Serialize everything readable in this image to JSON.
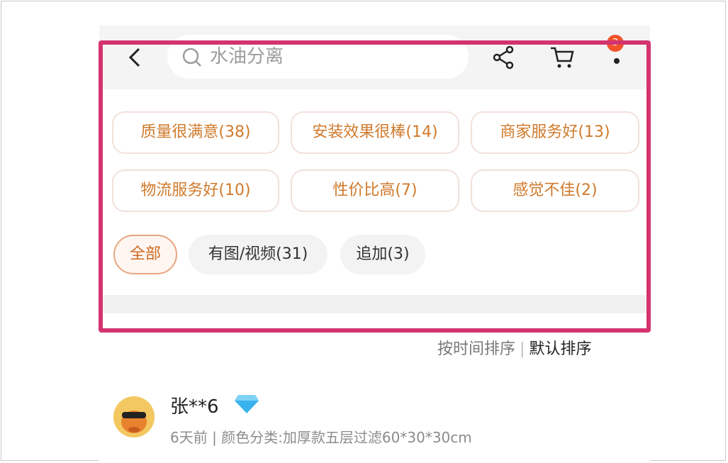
{
  "header": {
    "back_icon": "chevron-left-icon",
    "search_placeholder": "水油分离",
    "share_icon": "share-icon",
    "cart_icon": "cart-icon",
    "more_icon": "more-icon",
    "badge_count": "3"
  },
  "review_tags": [
    {
      "label": "质量很满意(38)"
    },
    {
      "label": "安装效果很棒(14)"
    },
    {
      "label": "商家服务好(13)"
    },
    {
      "label": "物流服务好(10)"
    },
    {
      "label": "性价比高(7)"
    },
    {
      "label": "感觉不佳(2)"
    }
  ],
  "filters": [
    {
      "label": "全部",
      "selected": true
    },
    {
      "label": "有图/视频(31)",
      "selected": false
    },
    {
      "label": "追加(3)",
      "selected": false
    }
  ],
  "sort": {
    "by_time": "按时间排序",
    "separator": "|",
    "default": "默认排序"
  },
  "review": {
    "username": "张**6",
    "badge_icon": "diamond-icon",
    "meta": "6天前 | 颜色分类:加厚款五层过滤60*30*30cm"
  },
  "colors": {
    "highlight": "#d4336f",
    "tag_text": "#d07a2c",
    "accent": "#f2532b"
  }
}
